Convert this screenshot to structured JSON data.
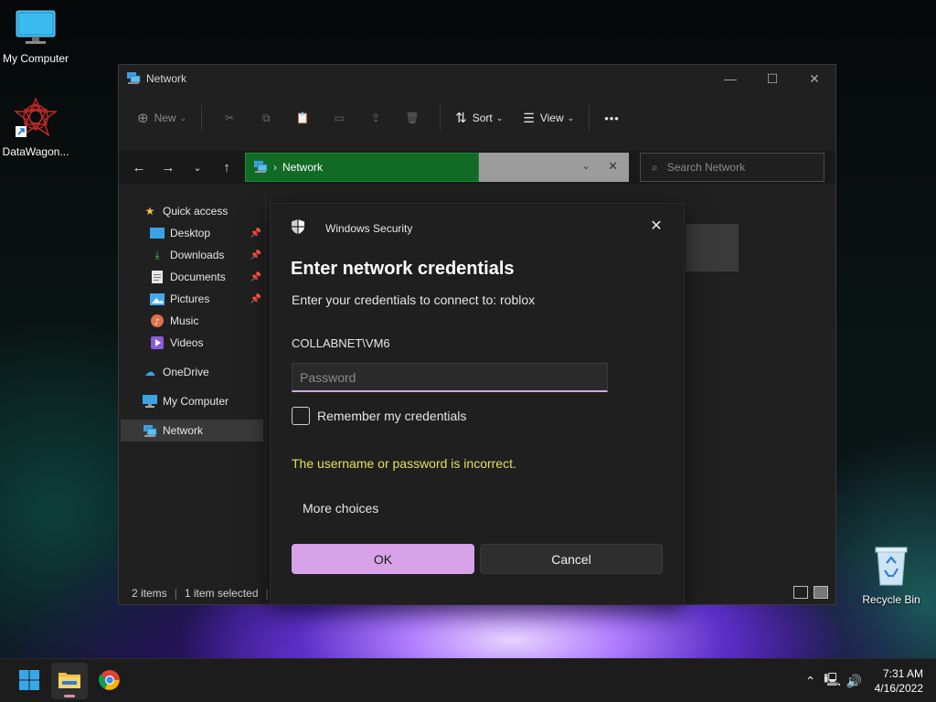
{
  "desktop": {
    "icons": [
      {
        "label": "My Computer"
      },
      {
        "label": "DataWagon..."
      },
      {
        "label": "Recycle Bin"
      }
    ]
  },
  "explorer": {
    "title": "Network",
    "toolbar": {
      "new_label": "New",
      "sort_label": "Sort",
      "view_label": "View",
      "more_label": "•••"
    },
    "address": {
      "segment": "Network"
    },
    "search_placeholder": "Search Network",
    "sidebar": {
      "quick_access": "Quick access",
      "items": [
        {
          "label": "Desktop",
          "pinned": true
        },
        {
          "label": "Downloads",
          "pinned": true
        },
        {
          "label": "Documents",
          "pinned": true
        },
        {
          "label": "Pictures",
          "pinned": true
        },
        {
          "label": "Music",
          "pinned": false
        },
        {
          "label": "Videos",
          "pinned": false
        }
      ],
      "onedrive": "OneDrive",
      "mycomputer": "My Computer",
      "network": "Network"
    },
    "status": {
      "items": "2 items",
      "selected": "1 item selected"
    }
  },
  "dialog": {
    "app_name": "Windows Security",
    "title": "Enter network credentials",
    "subtitle": "Enter your credentials to connect to: roblox",
    "username": "COLLABNET\\VM6",
    "password_placeholder": "Password",
    "remember_label": "Remember my credentials",
    "error": "The username or password is incorrect.",
    "more_choices": "More choices",
    "ok_label": "OK",
    "cancel_label": "Cancel"
  },
  "taskbar": {
    "time": "7:31 AM",
    "date": "4/16/2022"
  },
  "colors": {
    "accent": "#d8a2e8",
    "error": "#e1e161",
    "address_highlight": "#116b25"
  }
}
